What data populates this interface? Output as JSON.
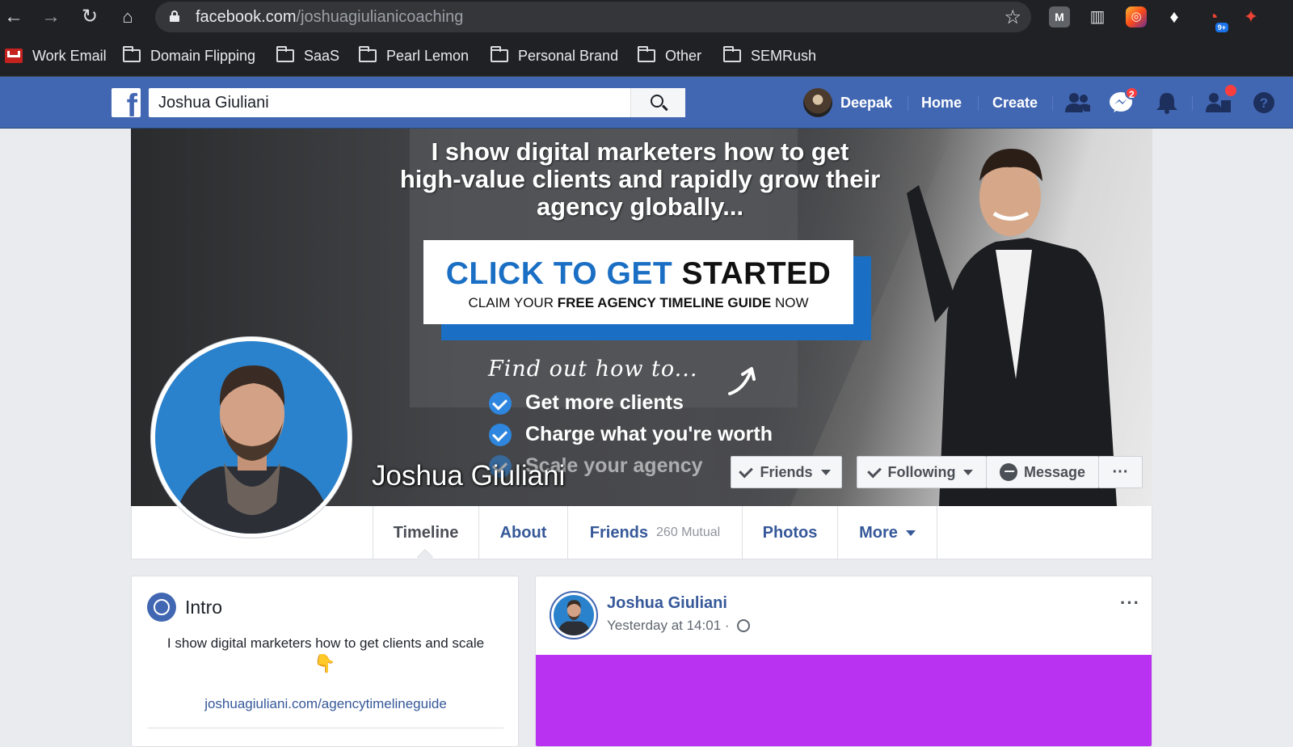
{
  "browser": {
    "url_domain": "facebook.com",
    "url_path": "/joshuagiulianicoaching",
    "bookmarks": [
      {
        "label": "Work Email",
        "icon": "gmail-icon"
      },
      {
        "label": "Domain Flipping",
        "icon": "folder-icon"
      },
      {
        "label": "SaaS",
        "icon": "folder-icon"
      },
      {
        "label": "Pearl Lemon",
        "icon": "folder-icon"
      },
      {
        "label": "Personal Brand",
        "icon": "folder-icon"
      },
      {
        "label": "Other",
        "icon": "folder-icon"
      },
      {
        "label": "SEMRush",
        "icon": "folder-icon"
      }
    ],
    "extension_badge": "9+"
  },
  "fb_header": {
    "logo": "f",
    "search_value": "Joshua Giuliani",
    "user_name": "Deepak",
    "home_label": "Home",
    "create_label": "Create",
    "messages_badge": "2",
    "brand_color": "#4267b2"
  },
  "cover": {
    "headline": "I show digital marketers how to get high-value clients and rapidly grow their agency globally...",
    "cta_blue": "CLICK TO GET",
    "cta_black": "STARTED",
    "cta_sub_1": "CLAIM YOUR",
    "cta_sub_2": "FREE AGENCY TIMELINE GUIDE",
    "cta_sub_3": "NOW",
    "find_out": "Find out how to...",
    "bullets": [
      "Get more clients",
      "Charge what you're worth",
      "Scale your agency"
    ]
  },
  "profile": {
    "name": "Joshua Giuliani",
    "friends_btn": "Friends",
    "following_btn": "Following",
    "message_btn": "Message",
    "more_btn": "···"
  },
  "tabs": {
    "timeline": "Timeline",
    "about": "About",
    "friends": "Friends",
    "friends_count": "260 Mutual",
    "photos": "Photos",
    "more": "More"
  },
  "intro": {
    "title": "Intro",
    "bio": "I show digital marketers how to get clients and scale",
    "emoji": "👇",
    "link": "joshuagiuliani.com/agencytimelineguide"
  },
  "post": {
    "author": "Joshua Giuliani",
    "time": "Yesterday at 14:01 ·",
    "more": "···",
    "media_color": "#b932f2"
  }
}
